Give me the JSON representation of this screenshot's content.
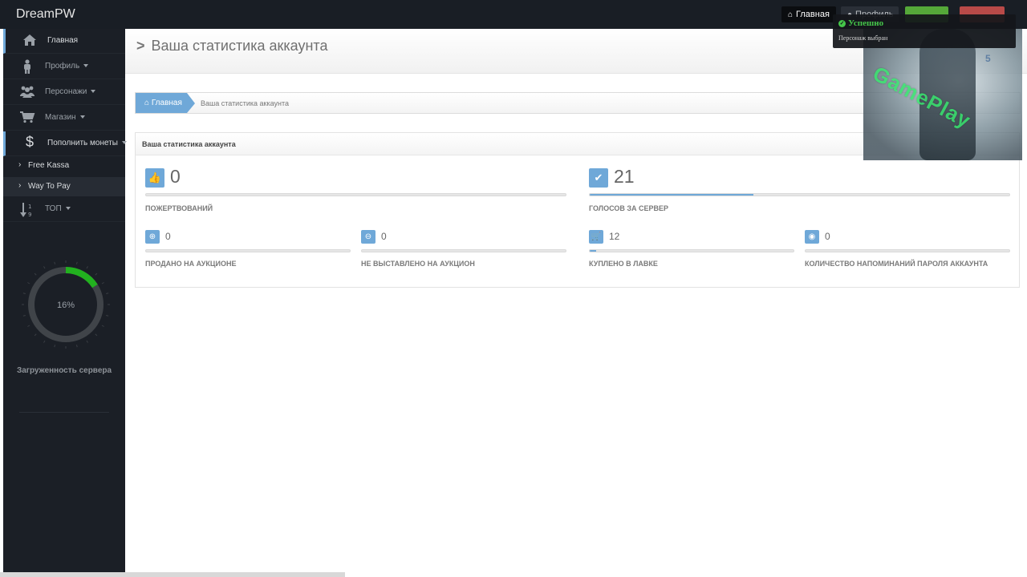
{
  "app": {
    "brand": "DreamPW"
  },
  "topbar": {
    "home_label": "Главная",
    "profile_label": "Профиль",
    "green_label": "",
    "red_label": ""
  },
  "sidebar": {
    "items": [
      {
        "label": "Главная",
        "icon": "home-icon"
      },
      {
        "label": "Профиль",
        "icon": "user-icon"
      },
      {
        "label": "Персонажи",
        "icon": "users-icon"
      },
      {
        "label": "Магазин",
        "icon": "cart-icon"
      },
      {
        "label": "Пополнить монеты",
        "icon": "dollar-icon"
      }
    ],
    "subitems": [
      {
        "label": "Free Kassa"
      },
      {
        "label": "Way To Pay"
      }
    ],
    "top_item": {
      "label": "ТОП",
      "icon": "sort-numeric-icon"
    },
    "server_load": {
      "percent": 16,
      "percent_text": "16%",
      "label": "Загруженность сервера"
    }
  },
  "page": {
    "title": "Ваша статистика аккаунта",
    "breadcrumb": {
      "home": "Главная",
      "current": "Ваша статистика аккаунта"
    }
  },
  "panel": {
    "title": "Ваша статистика аккаунта",
    "stats_big": [
      {
        "value": "0",
        "label": "ПОЖЕРТВОВАНИЙ",
        "progress": 0,
        "icon": "thumbs-up-icon"
      },
      {
        "value": "21",
        "label": "ГОЛОСОВ ЗА СЕРВЕР",
        "progress": 0.39,
        "icon": "check-icon"
      }
    ],
    "stats_small": [
      {
        "value": "0",
        "label": "ПРОДАНО НА АУКЦИОНЕ",
        "progress": 0,
        "icon": "plus-circle-icon"
      },
      {
        "value": "0",
        "label": "НЕ ВЫСТАВЛЕНО НА АУКЦИОН",
        "progress": 0,
        "icon": "minus-circle-icon"
      },
      {
        "value": "12",
        "label": "КУПЛЕНО В ЛАВКЕ",
        "progress": 0.03,
        "icon": "cart-icon"
      },
      {
        "value": "0",
        "label": "КОЛИЧЕСТВО НАПОМИНАНИЙ ПАРОЛЯ АККАУНТА",
        "progress": 0,
        "icon": "eye-icon"
      }
    ]
  },
  "toast": {
    "title": "Успешно",
    "message": "Персонаж выбран"
  },
  "watermark": {
    "number": "5"
  },
  "colors": {
    "accent": "#6fa8d8",
    "sidebar": "#1b1f26",
    "topbar": "#191e25",
    "gauge": "#22b11f",
    "success": "#45c64a"
  }
}
